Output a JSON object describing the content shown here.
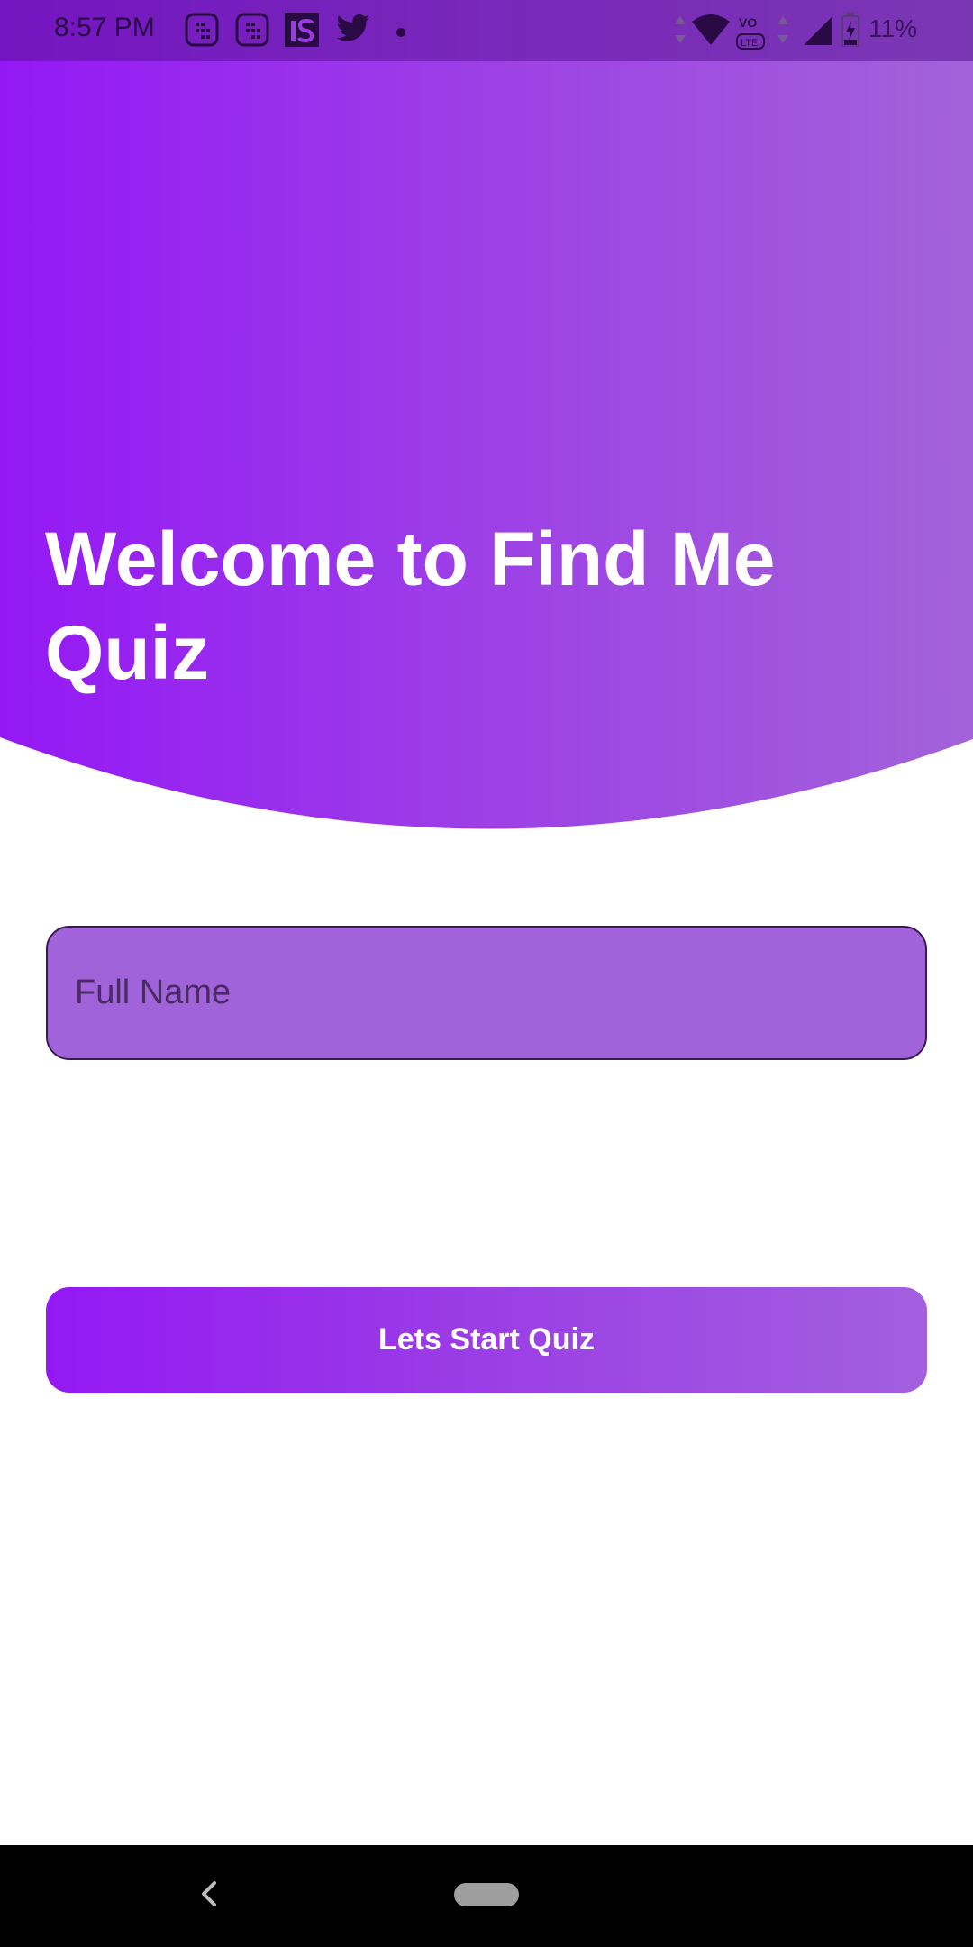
{
  "status_bar": {
    "time": "8:57 PM",
    "battery": "11%",
    "icons": [
      "calendar-icon",
      "calendar-icon",
      "is-app-icon",
      "twitter-icon",
      "dot-icon",
      "data-arrows-icon",
      "wifi-icon",
      "volte-icon",
      "data-arrows-icon",
      "signal-icon",
      "battery-charging-icon"
    ]
  },
  "hero": {
    "title": "Welcome to Find Me Quiz",
    "gradient_start": "#9418f5",
    "gradient_end": "#a362d9"
  },
  "form": {
    "name_placeholder": "Full Name",
    "name_value": "",
    "start_button_label": "Lets Start Quiz"
  },
  "nav": {
    "icons": [
      "back-icon",
      "home-pill-icon"
    ]
  },
  "colors": {
    "accent": "#9418f5",
    "field_bg": "#a063d9",
    "field_border": "#3a1a52"
  }
}
